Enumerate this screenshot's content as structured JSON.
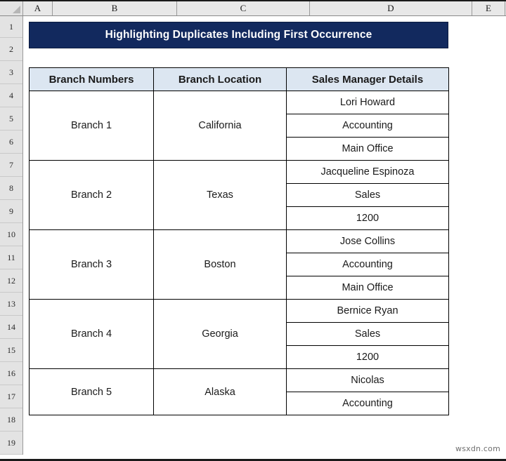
{
  "spreadsheet": {
    "select_all_icon": "select-all-triangle-icon",
    "column_headers": [
      "A",
      "B",
      "C",
      "D",
      "E"
    ],
    "row_headers": [
      "1",
      "2",
      "3",
      "4",
      "5",
      "6",
      "7",
      "8",
      "9",
      "10",
      "11",
      "12",
      "13",
      "14",
      "15",
      "16",
      "17",
      "18",
      "19"
    ]
  },
  "banner": {
    "title": "Highlighting Duplicates Including First Occurrence",
    "background_color": "#12295E",
    "text_color": "#FFFFFF"
  },
  "table": {
    "header_background_color": "#DCE6F1",
    "duplicate_text_color": "#E01B1B",
    "normal_text_color": "#1A1A1A",
    "columns": [
      "Branch Numbers",
      "Branch Location",
      "Sales Manager Details"
    ],
    "groups": [
      {
        "branch": "Branch 1",
        "location": "California",
        "details": [
          {
            "value": "Lori Howard",
            "duplicate": false
          },
          {
            "value": "Accounting",
            "duplicate": true
          },
          {
            "value": "Main Office",
            "duplicate": true
          }
        ]
      },
      {
        "branch": "Branch 2",
        "location": "Texas",
        "details": [
          {
            "value": "Jacqueline Espinoza",
            "duplicate": false
          },
          {
            "value": "Sales",
            "duplicate": true
          },
          {
            "value": "1200",
            "duplicate": true
          }
        ]
      },
      {
        "branch": "Branch 3",
        "location": "Boston",
        "details": [
          {
            "value": "Jose Collins",
            "duplicate": false
          },
          {
            "value": "Accounting",
            "duplicate": true
          },
          {
            "value": "Main Office",
            "duplicate": true
          }
        ]
      },
      {
        "branch": "Branch 4",
        "location": "Georgia",
        "details": [
          {
            "value": "Bernice Ryan",
            "duplicate": false
          },
          {
            "value": "Sales",
            "duplicate": true
          },
          {
            "value": "1200",
            "duplicate": true
          }
        ]
      },
      {
        "branch": "Branch 5",
        "location": "Alaska",
        "details": [
          {
            "value": "Nicolas",
            "duplicate": false
          },
          {
            "value": "Accounting",
            "duplicate": true
          }
        ]
      }
    ]
  },
  "watermark": {
    "text": "wsxdn.com"
  }
}
